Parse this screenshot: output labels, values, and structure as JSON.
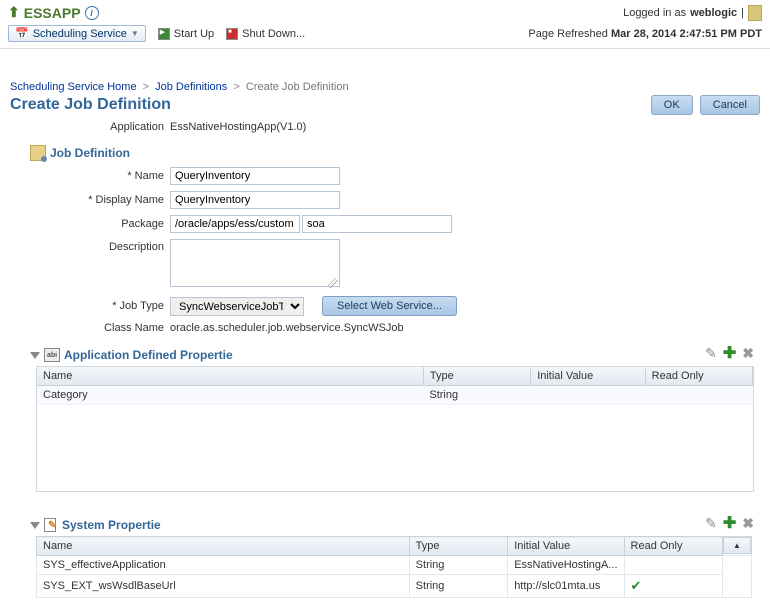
{
  "header": {
    "app_name": "ESSAPP",
    "logged_in_prefix": "Logged in as",
    "user": "weblogic",
    "refresh_prefix": "Page Refreshed",
    "refresh_time": "Mar 28, 2014 2:47:51 PM PDT"
  },
  "toolbar": {
    "scheduling_service": "Scheduling Service",
    "start_up": "Start Up",
    "shut_down": "Shut Down..."
  },
  "breadcrumb": {
    "home": "Scheduling Service Home",
    "job_defs": "Job Definitions",
    "current": "Create Job Definition"
  },
  "page": {
    "title": "Create Job Definition",
    "ok": "OK",
    "cancel": "Cancel"
  },
  "form": {
    "application_label": "Application",
    "application_value": "EssNativeHostingApp(V1.0)",
    "section_job_def": "Job Definition",
    "name_label": "Name",
    "name_value": "QueryInventory",
    "display_name_label": "Display Name",
    "display_name_value": "QueryInventory",
    "package_label": "Package",
    "package_value1": "/oracle/apps/ess/custom",
    "package_value2": "soa",
    "description_label": "Description",
    "description_value": "",
    "job_type_label": "Job Type",
    "job_type_value": "SyncWebserviceJobType",
    "select_ws": "Select Web Service...",
    "class_name_label": "Class Name",
    "class_name_value": "oracle.as.scheduler.job.webservice.SyncWSJob"
  },
  "app_props": {
    "title": "Application Defined Propertie",
    "cols": {
      "name": "Name",
      "type": "Type",
      "initial": "Initial Value",
      "readonly": "Read Only"
    },
    "rows": [
      {
        "name": "Category",
        "type": "String",
        "initial": "",
        "readonly": ""
      }
    ]
  },
  "sys_props": {
    "title": "System Propertie",
    "cols": {
      "name": "Name",
      "type": "Type",
      "initial": "Initial Value",
      "readonly": "Read Only"
    },
    "rows": [
      {
        "name": "SYS_effectiveApplication",
        "type": "String",
        "initial": "EssNativeHostingA...",
        "readonly": false
      },
      {
        "name": "SYS_EXT_wsWsdlBaseUrl",
        "type": "String",
        "initial": "http://slc01mta.us",
        "readonly": true
      }
    ]
  }
}
